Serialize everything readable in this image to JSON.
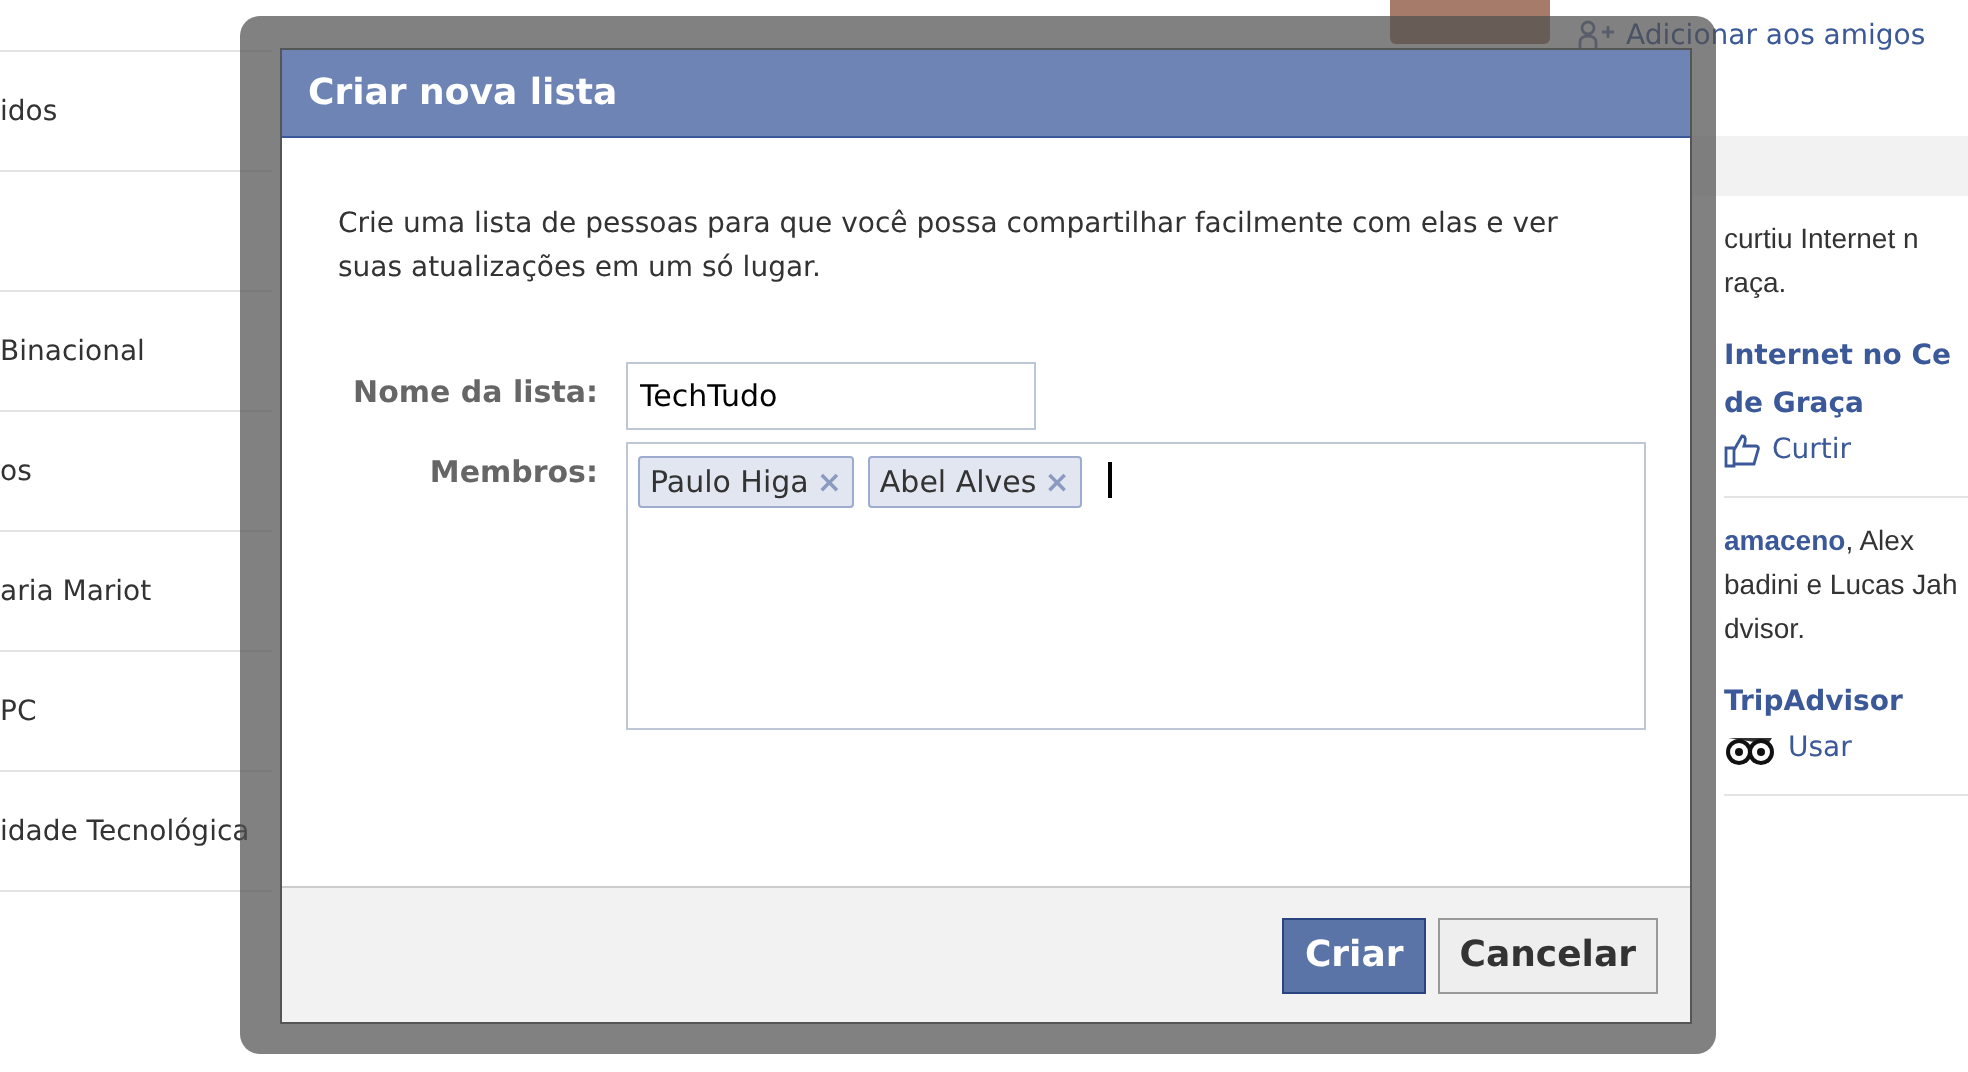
{
  "background": {
    "left_list": [
      "idos",
      "Binacional",
      "os",
      "aria Mariot",
      "PC",
      "idade Tecnológica"
    ],
    "right": {
      "add_friend_link": "Adicionar aos amigos",
      "feed": [
        {
          "lines": [
            "curtiu Internet n",
            "raça."
          ],
          "page_title": [
            "Internet no Ce",
            "de Graça"
          ],
          "action": {
            "kind": "like",
            "label": "Curtir"
          }
        },
        {
          "lines": [
            "**amaceno**, Alex",
            "badini e Lucas Jah",
            "dvisor."
          ],
          "page_title": [
            "TripAdvisor"
          ],
          "action": {
            "kind": "app",
            "label": "Usar"
          }
        }
      ]
    }
  },
  "dialog": {
    "title": "Criar nova lista",
    "description": "Crie uma lista de pessoas para que você possa compartilhar facilmente com elas e ver suas atualizações em um só lugar.",
    "name_field": {
      "label": "Nome da lista:",
      "value": "TechTudo"
    },
    "members_field": {
      "label": "Membros:",
      "tokens": [
        "Paulo Higa",
        "Abel Alves"
      ],
      "remove_glyph": "×"
    },
    "buttons": [
      {
        "kind": "primary",
        "label": "Criar"
      },
      {
        "kind": "secondary",
        "label": "Cancelar"
      }
    ]
  }
}
